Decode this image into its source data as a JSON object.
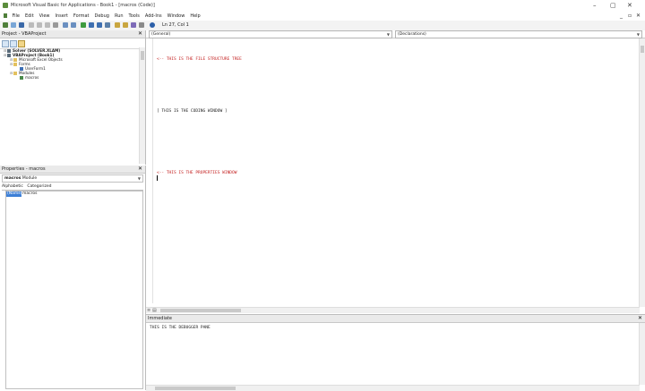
{
  "window": {
    "title": "Microsoft Visual Basic for Applications - Book1 - [macros (Code)]",
    "controls": {
      "minimize": "–",
      "maximize": "▢",
      "close": "✕"
    },
    "mdi_controls": {
      "minimize": "_",
      "restore": "▫",
      "close": "✕"
    }
  },
  "menu": [
    "File",
    "Edit",
    "View",
    "Insert",
    "Format",
    "Debug",
    "Run",
    "Tools",
    "Add-Ins",
    "Window",
    "Help"
  ],
  "toolbar": {
    "position_label": "Ln 27, Col 1"
  },
  "project_pane": {
    "title": "Project - VBAProject",
    "close": "✕",
    "tree": [
      {
        "label": "Solver (SOLVER.XLAM)",
        "bold": true,
        "level": 0,
        "icon": "vba-project-icon"
      },
      {
        "label": "VBAProject (Book1)",
        "bold": true,
        "level": 0,
        "icon": "vba-project-icon"
      },
      {
        "label": "Microsoft Excel Objects",
        "bold": false,
        "level": 1,
        "icon": "folder-icon"
      },
      {
        "label": "Forms",
        "bold": false,
        "level": 1,
        "icon": "folder-icon"
      },
      {
        "label": "UserForm1",
        "bold": false,
        "level": 2,
        "icon": "userform-icon"
      },
      {
        "label": "Modules",
        "bold": false,
        "level": 1,
        "icon": "folder-icon"
      },
      {
        "label": "macros",
        "bold": false,
        "level": 2,
        "icon": "module-icon"
      }
    ]
  },
  "properties_pane": {
    "title": "Properties - macros",
    "close": "✕",
    "object_combo": {
      "name": "macros",
      "type": "Module"
    },
    "tabs": [
      "Alphabetic",
      "Categorized"
    ],
    "rows": [
      {
        "name": "(Name)",
        "value": "macros"
      }
    ]
  },
  "code_window": {
    "object_combo": "(General)",
    "procedure_combo": "(Declarations)",
    "lines": [
      "<-- THIS IS THE FILE STRUCTURE TREE",
      "[ THIS IS THE CODING WINDOW ]",
      "<-- THIS IS THE PROPERTIES WINDOW"
    ]
  },
  "immediate_window": {
    "title": "Immediate",
    "close": "✕",
    "text": "THIS IS THE DEBUGGER PANE"
  },
  "colors": {
    "annotation_red": "#c42222",
    "selection_blue": "#3d7fd6"
  }
}
